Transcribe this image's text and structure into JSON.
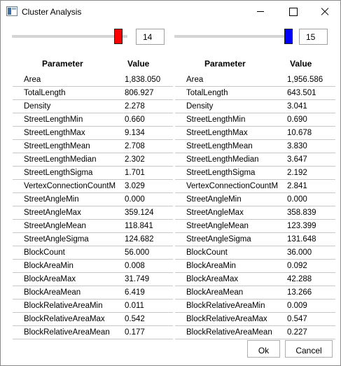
{
  "window": {
    "title": "Cluster Analysis"
  },
  "colors": {
    "left_thumb": "#ff0000",
    "right_thumb": "#0000ff"
  },
  "controls": {
    "left_value": "14",
    "right_value": "15",
    "ok_label": "Ok",
    "cancel_label": "Cancel"
  },
  "left": {
    "header": {
      "parameter": "Parameter",
      "value": "Value"
    },
    "rows": [
      {
        "name": "Area",
        "value": "1,838.050"
      },
      {
        "name": "TotalLength",
        "value": "806.927"
      },
      {
        "name": "Density",
        "value": "2.278"
      },
      {
        "name": "StreetLengthMin",
        "value": "0.660"
      },
      {
        "name": "StreetLengthMax",
        "value": "9.134"
      },
      {
        "name": "StreetLengthMean",
        "value": "2.708"
      },
      {
        "name": "StreetLengthMedian",
        "value": "2.302"
      },
      {
        "name": "StreetLengthSigma",
        "value": "1.701"
      },
      {
        "name": "VertexConnectionCountM",
        "value": "3.029"
      },
      {
        "name": "StreetAngleMin",
        "value": "0.000"
      },
      {
        "name": "StreetAngleMax",
        "value": "359.124"
      },
      {
        "name": "StreetAngleMean",
        "value": "118.841"
      },
      {
        "name": "StreetAngleSigma",
        "value": "124.682"
      },
      {
        "name": "BlockCount",
        "value": "56.000"
      },
      {
        "name": "BlockAreaMin",
        "value": "0.008"
      },
      {
        "name": "BlockAreaMax",
        "value": "31.749"
      },
      {
        "name": "BlockAreaMean",
        "value": "6.419"
      },
      {
        "name": "BlockRelativeAreaMin",
        "value": "0.011"
      },
      {
        "name": "BlockRelativeAreaMax",
        "value": "0.542"
      },
      {
        "name": "BlockRelativeAreaMean",
        "value": "0.177"
      }
    ]
  },
  "right": {
    "header": {
      "parameter": "Parameter",
      "value": "Value"
    },
    "rows": [
      {
        "name": "Area",
        "value": "1,956.586"
      },
      {
        "name": "TotalLength",
        "value": "643.501"
      },
      {
        "name": "Density",
        "value": "3.041"
      },
      {
        "name": "StreetLengthMin",
        "value": "0.690"
      },
      {
        "name": "StreetLengthMax",
        "value": "10.678"
      },
      {
        "name": "StreetLengthMean",
        "value": "3.830"
      },
      {
        "name": "StreetLengthMedian",
        "value": "3.647"
      },
      {
        "name": "StreetLengthSigma",
        "value": "2.192"
      },
      {
        "name": "VertexConnectionCountM",
        "value": "2.841"
      },
      {
        "name": "StreetAngleMin",
        "value": "0.000"
      },
      {
        "name": "StreetAngleMax",
        "value": "358.839"
      },
      {
        "name": "StreetAngleMean",
        "value": "123.399"
      },
      {
        "name": "StreetAngleSigma",
        "value": "131.648"
      },
      {
        "name": "BlockCount",
        "value": "36.000"
      },
      {
        "name": "BlockAreaMin",
        "value": "0.092"
      },
      {
        "name": "BlockAreaMax",
        "value": "42.288"
      },
      {
        "name": "BlockAreaMean",
        "value": "13.266"
      },
      {
        "name": "BlockRelativeAreaMin",
        "value": "0.009"
      },
      {
        "name": "BlockRelativeAreaMax",
        "value": "0.547"
      },
      {
        "name": "BlockRelativeAreaMean",
        "value": "0.227"
      }
    ]
  }
}
